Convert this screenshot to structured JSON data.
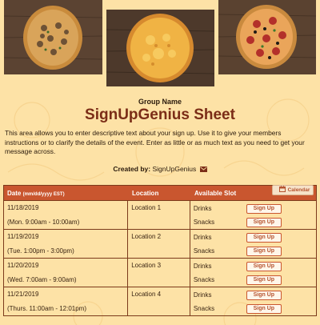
{
  "banner": {
    "images": [
      "mushroom-pizza-photo",
      "cheese-pizza-photo",
      "pepperoni-pizza-photo"
    ]
  },
  "header": {
    "group_name": "Group Name",
    "title": "SignUpGenius Sheet",
    "description": "This area allows you to enter descriptive text about your sign up. Use it to give your members instructions or to clarify the details of the event. Enter as little or as much text as you need to get your message across.",
    "created_by_label": "Created by:",
    "created_by_name": "SignUpGenius",
    "mail_icon": "mail-icon"
  },
  "table": {
    "col_date": "Date",
    "col_date_format": "(mm/dd/yyyy EST)",
    "col_location": "Location",
    "col_slot": "Available Slot",
    "calendar_label": "Calendar",
    "signup_label": "Sign Up",
    "rows": [
      {
        "date": "11/18/2019",
        "time": "(Mon. 9:00am - 10:00am)",
        "location": "Location 1",
        "slots": [
          "Drinks",
          "Snacks"
        ]
      },
      {
        "date": "11/19/2019",
        "time": "(Tue. 1:00pm - 3:00pm)",
        "location": "Location 2",
        "slots": [
          "Drinks",
          "Snacks"
        ]
      },
      {
        "date": "11/20/2019",
        "time": "(Wed. 7:00am - 9:00am)",
        "location": "Location 3",
        "slots": [
          "Drinks",
          "Snacks"
        ]
      },
      {
        "date": "11/21/2019",
        "time": "(Thurs. 11:00am - 12:01pm)",
        "location": "Location 4",
        "slots": [
          "Drinks",
          "Snacks"
        ]
      }
    ]
  },
  "colors": {
    "background": "#fde2a6",
    "title": "#7b2d17",
    "table_header": "#c9562f",
    "border": "#7b3a1b"
  }
}
